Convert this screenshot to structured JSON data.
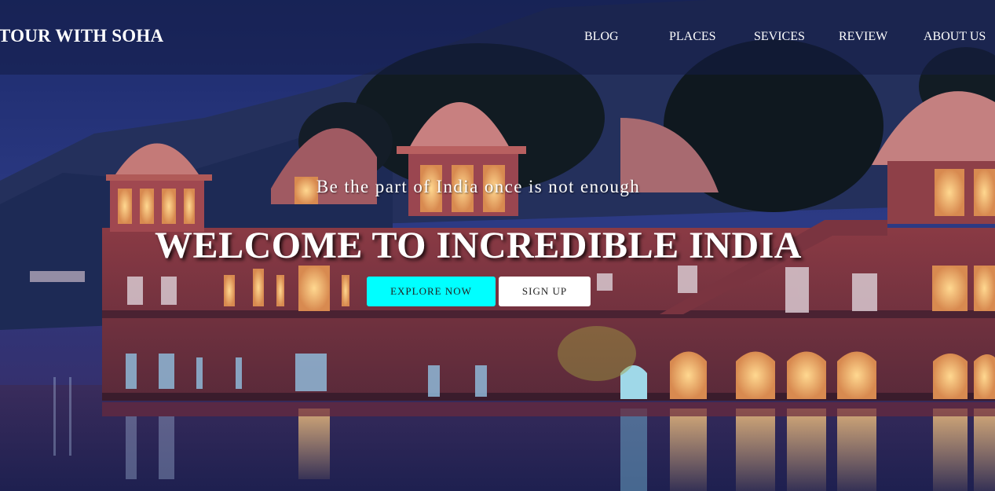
{
  "brand": {
    "title": "TOUR WITH SOHA"
  },
  "nav": {
    "items": [
      {
        "label": "BLOG"
      },
      {
        "label": "PLACES"
      },
      {
        "label": "SEVICES"
      },
      {
        "label": "REVIEW"
      },
      {
        "label": "ABOUT US"
      }
    ]
  },
  "hero": {
    "tagline": "Be the part of India once is not enough",
    "headline": "WELCOME TO INCREDIBLE INDIA",
    "explore_label": "EXPLORE NOW",
    "signup_label": "SIGN UP"
  },
  "colors": {
    "accent": "#00ffff",
    "navbar": "#141e46",
    "text": "#ffffff"
  }
}
